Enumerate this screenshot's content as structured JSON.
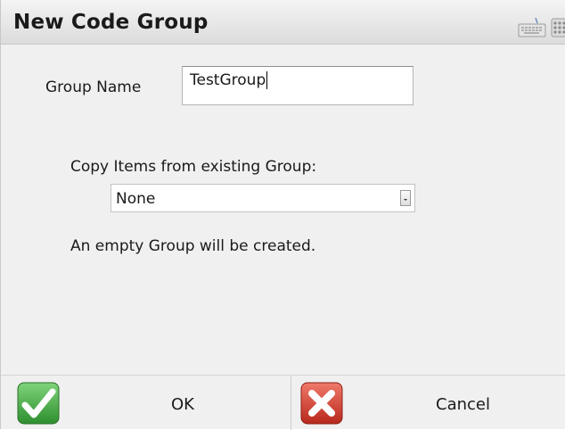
{
  "dialog": {
    "title": "New Code Group"
  },
  "icons": {
    "keyboard": "keyboard-icon",
    "keypad": "keypad-icon",
    "ok": "checkmark-icon",
    "cancel": "x-mark-icon"
  },
  "form": {
    "group_name_label": "Group Name",
    "group_name_value": "TestGroup",
    "copy_label": "Copy Items from existing Group:",
    "copy_selected": "None",
    "info_text": "An empty Group will be created."
  },
  "buttons": {
    "ok_label": "OK",
    "cancel_label": "Cancel"
  },
  "colors": {
    "ok_green": "#3aa43a",
    "cancel_red": "#d23a2a",
    "background": "#f0f0f0"
  }
}
